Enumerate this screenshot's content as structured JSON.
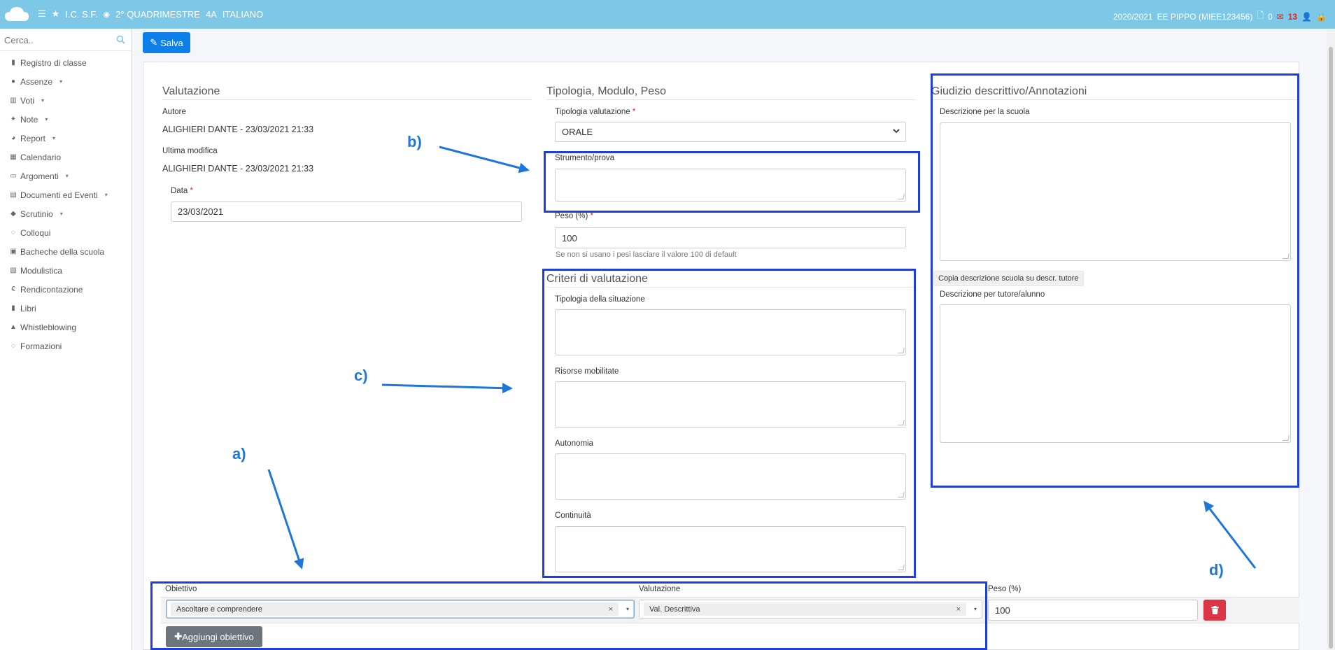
{
  "topbar": {
    "school": "I.C. S.F.",
    "period": "2° QUADRIMESTRE",
    "class": "4A",
    "subject": "ITALIANO",
    "year": "2020/2021",
    "user": "EE PIPPO (MIEE123456)",
    "docs_count": "0",
    "mail_count": "13"
  },
  "sidebar": {
    "search_placeholder": "Cerca..",
    "items": [
      {
        "label": "Registro di classe",
        "icon": "book-icon",
        "caret": ""
      },
      {
        "label": "Assenze",
        "icon": "user-icon",
        "caret": "▾"
      },
      {
        "label": "Voti",
        "icon": "institution-icon",
        "caret": "▾"
      },
      {
        "label": "Note",
        "icon": "pin-icon",
        "caret": "▾"
      },
      {
        "label": "Report",
        "icon": "pie-chart-icon",
        "caret": "▾"
      },
      {
        "label": "Calendario",
        "icon": "calendar-icon",
        "caret": ""
      },
      {
        "label": "Argomenti",
        "icon": "folder-icon",
        "caret": "▾"
      },
      {
        "label": "Documenti ed Eventi",
        "icon": "document-icon",
        "caret": "▾"
      },
      {
        "label": "Scrutinio",
        "icon": "graduation-cap-icon",
        "caret": "▾"
      },
      {
        "label": "Colloqui",
        "icon": "chat-icon",
        "caret": ""
      },
      {
        "label": "Bacheche della scuola",
        "icon": "board-icon",
        "caret": ""
      },
      {
        "label": "Modulistica",
        "icon": "clipboard-icon",
        "caret": ""
      },
      {
        "label": "Rendicontazione",
        "icon": "euro-icon",
        "caret": ""
      },
      {
        "label": "Libri",
        "icon": "book-icon",
        "caret": ""
      },
      {
        "label": "Whistleblowing",
        "icon": "lock-icon",
        "caret": ""
      },
      {
        "label": "Formazioni",
        "icon": "chat-icon",
        "caret": ""
      }
    ]
  },
  "toolbar": {
    "save_label": "Salva"
  },
  "valutazione": {
    "title": "Valutazione",
    "autore_label": "Autore",
    "autore_value": "ALIGHIERI DANTE - 23/03/2021 21:33",
    "modifica_label": "Ultima modifica",
    "modifica_value": "ALIGHIERI DANTE - 23/03/2021 21:33",
    "data_label": "Data",
    "data_value": "23/03/2021"
  },
  "tipologia": {
    "title": "Tipologia, Modulo, Peso",
    "tipologia_label": "Tipologia valutazione",
    "tipologia_value": "ORALE",
    "strumento_label": "Strumento/prova",
    "peso_label": "Peso (%)",
    "peso_value": "100",
    "peso_hint": "Se non si usano i pesi lasciare il valore 100 di default"
  },
  "criteri": {
    "title": "Criteri di valutazione",
    "situazione_label": "Tipologia della situazione",
    "risorse_label": "Risorse mobilitate",
    "autonomia_label": "Autonomia",
    "continuita_label": "Continuità"
  },
  "giudizio": {
    "title": "Giudizio descrittivo/Annotazioni",
    "scuola_label": "Descrizione per la scuola",
    "copy_label": "Copia descrizione scuola su descr. tutore",
    "tutore_label": "Descrizione per tutore/alunno"
  },
  "obiettivi": {
    "obiettivo_header": "Obiettivo",
    "valutazione_header": "Valutazione",
    "peso_header": "Peso (%)",
    "obiettivo_value": "Ascoltare e comprendere",
    "valutazione_value": "Val. Descrittiva",
    "peso_value": "100",
    "add_label": "Aggiungi obiettivo"
  },
  "callouts": {
    "a": "a)",
    "b": "b)",
    "c": "c)",
    "d": "d)"
  },
  "colors": {
    "topbar": "#7dc8e6",
    "primary": "#0d7fe8",
    "danger": "#dc3545",
    "highlight": "#1f3fd6",
    "callout": "#1e76d8"
  }
}
